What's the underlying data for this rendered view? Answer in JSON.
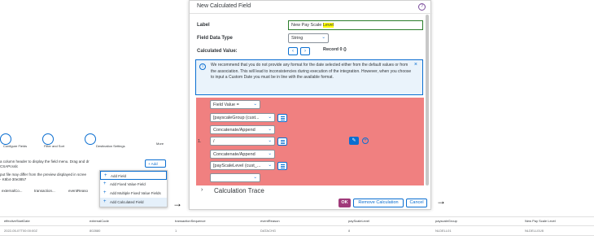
{
  "left_panel": {
    "toolbar": {
      "configure_fields": "Configure Fields",
      "filter_sort": "Filter and Sort",
      "destination_settings": "Destination Settings",
      "more": "More"
    },
    "hint_line1": "a column header to display the field menu. Drag and dr",
    "hint_line2": "CSAPcsslc",
    "add_button": "Add",
    "warning_line1": "put file may differ from the preview displayed in scree",
    "warning_line2": "- K8b4-30e3857",
    "menu": [
      "Add Field",
      "Add Fixed Value Field",
      "Add Multiple Fixed Value Fields",
      "Add Calculated Field"
    ],
    "columns": [
      "externalCo...",
      "transaction...",
      "eventReaso"
    ]
  },
  "dialog": {
    "title": "New Calculated Field",
    "label_label": "Label",
    "label_value_prefix": "New Pay Scale ",
    "label_value_highlight": "Level",
    "field_data_type_label": "Field Data Type",
    "field_data_type_value": "String",
    "calculated_value_label": "Calculated Value:",
    "record_text": "Record 0 ()",
    "info_text": "We recommend that you do not provide any format for the date selected either from the default values or from the association. This will lead to inconsistencies during execution of the integration. However, when you choose to input a Custom Date you must be in line with the available format.",
    "row_number": "1.",
    "selects": [
      "Field Value =",
      "[payscaleGroup (cust...",
      "Concatenate/Append",
      "/",
      "Concatenate/Append",
      "[payScaleLevel (cust_...",
      ""
    ],
    "calc_trace_label": "Calculation Trace",
    "ok_label": "OK",
    "remove_label": "Remove Calculation",
    "cancel_label": "Cancel"
  },
  "arrows": [
    "→",
    "→"
  ],
  "preview_table": {
    "headers": [
      "effectiveStartDate",
      "externalCode",
      "transactionSequence",
      "eventReason",
      "payScaleLevel",
      "payscaleGroup",
      "New Pay Scale Level"
    ],
    "row": [
      "2022-05-07T00:00:00Z",
      "802880",
      "1",
      "DATACHG",
      "8",
      "NLDELL01",
      "NLDELL01/8"
    ]
  },
  "colors": {
    "accent": "#0a6ed1",
    "highlight_area": "#f08080",
    "ok_button": "#a03a7a",
    "info_bg": "#eaf3fb"
  }
}
